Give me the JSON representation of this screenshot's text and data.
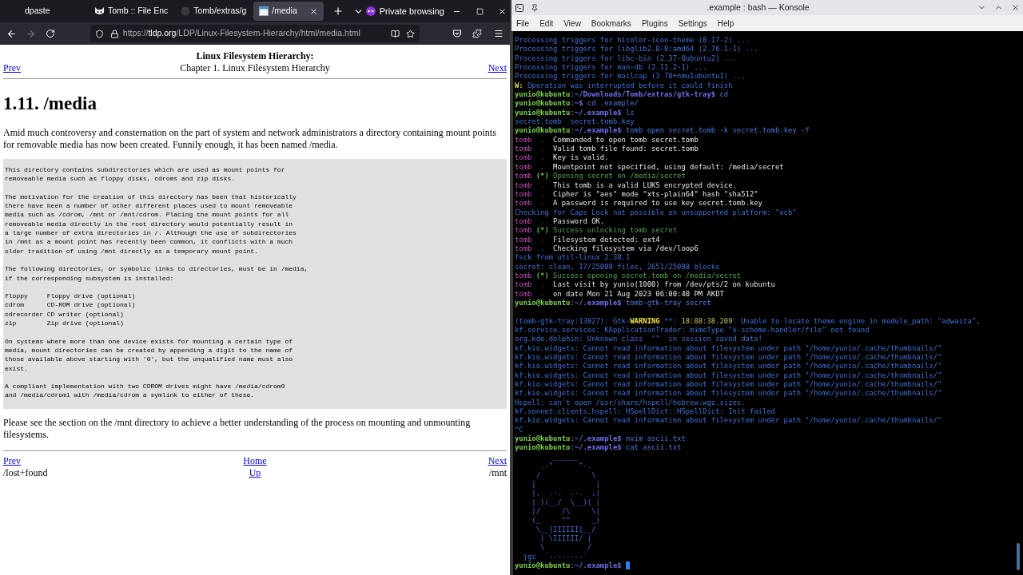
{
  "browser": {
    "tabs": [
      {
        "label": "dpaste",
        "selected": false
      },
      {
        "label": "Tomb :: File Enc",
        "selected": false
      },
      {
        "label": "Tomb/extras/g",
        "selected": false
      },
      {
        "label": "/media",
        "selected": true
      }
    ],
    "private_label": "Private browsing",
    "url": {
      "scheme": "https://",
      "host": "tldp.org",
      "path": "/LDP/Linux-Filesystem-Hierarchy/html/media.html"
    }
  },
  "page": {
    "book_title": "Linux Filesystem Hierarchy:",
    "chapter": "Chapter 1. Linux Filesystem Hierarchy",
    "prev": "Prev",
    "next": "Next",
    "heading": "1.11. /media",
    "intro": "Amid much controversy and consternation on the part of system and network administrators a directory containing mount points for removable media has now been created. Funnily enough, it has been named /media.",
    "pre": "This directory contains subdirectories which are used as mount points for\nremoveable media such as floppy disks, cdroms and zip disks.\n\nThe motivation for the creation of this directory has been that historically\nthere have been a number of other different places used to mount removeable\nmedia such as /cdrom, /mnt or /mnt/cdrom. Placing the mount points for all\nremoveable media directly in the root directory would potentially result in\na large number of extra directories in /. Although the use of subdirectories\nin /mnt as a mount point has recently been common, it conflicts with a much\nolder tradition of using /mnt directly as a temporary mount point.\n\nThe following directories, or symbolic links to directories, must be in /media,\nif the corresponding subsystem is installed:\n\nfloppy     Floppy drive (optional)\ncdrom      CD-ROM drive (optional)\ncdrecorder CD writer (optional)\nzip        Zip drive (optional)\n\nOn systems where more than one device exists for mounting a certain type of\nmedia, mount directories can be created by appending a digit to the name of\nthose available above starting with '0', but the unqualified name must also\nexist.\n\nA compliant implementation with two CDROM drives might have /media/cdrom0\nand /media/cdrom1 with /media/cdrom a symlink to either of these.",
    "outro": "Please see the section on the /mnt directory to achieve a better understanding of the process on mounting and unmounting filesystems.",
    "footer": {
      "prev": "Prev",
      "home": "Home",
      "next": "Next",
      "prev_title": "/lost+found",
      "up": "Up",
      "next_title": "/mnt"
    }
  },
  "konsole": {
    "title": ".example : bash — Konsole",
    "menu": [
      "File",
      "Edit",
      "View",
      "Bookmarks",
      "Plugins",
      "Settings",
      "Help"
    ],
    "lines": [
      {
        "kind": "text",
        "segments": [
          {
            "kind": "info",
            "text": "Processing triggers for hicolor-icon-theme (0.17-2) ..."
          }
        ]
      },
      {
        "kind": "text",
        "segments": [
          {
            "kind": "info",
            "text": "Processing triggers for libglib2.0-0:amd64 (2.76.1-1) ..."
          }
        ]
      },
      {
        "kind": "text",
        "segments": [
          {
            "kind": "info",
            "text": "Processing triggers for libc-bin (2.37-0ubuntu2) ..."
          }
        ]
      },
      {
        "kind": "text",
        "segments": [
          {
            "kind": "info",
            "text": "Processing triggers for man-db (2.11.2-1) ..."
          }
        ]
      },
      {
        "kind": "text",
        "segments": [
          {
            "kind": "info",
            "text": "Processing triggers for mailcap (3.70+nmu1ubuntu1) ..."
          }
        ]
      },
      {
        "kind": "text",
        "segments": [
          {
            "kind": "warn",
            "text": "W:"
          },
          {
            "kind": "info",
            "text": " Operation was interrupted before it could finish"
          }
        ]
      },
      {
        "kind": "text",
        "segments": [
          {
            "kind": "user",
            "text": "yunio@kubuntu"
          },
          {
            "kind": "sep",
            "text": ":"
          },
          {
            "kind": "path",
            "text": "~/Downloads/Tomb/extras/gtk-tray$"
          },
          {
            "kind": "cmd",
            "text": " cd"
          }
        ]
      },
      {
        "kind": "text",
        "segments": [
          {
            "kind": "user",
            "text": "yunio@kubuntu"
          },
          {
            "kind": "sep",
            "text": ":"
          },
          {
            "kind": "path",
            "text": "~$"
          },
          {
            "kind": "cmd",
            "text": " cd .example/"
          }
        ]
      },
      {
        "kind": "text",
        "segments": [
          {
            "kind": "user",
            "text": "yunio@kubuntu"
          },
          {
            "kind": "sep",
            "text": ":"
          },
          {
            "kind": "path",
            "text": "~/.example$"
          },
          {
            "kind": "cmd",
            "text": " ls"
          }
        ]
      },
      {
        "kind": "text",
        "segments": [
          {
            "kind": "info",
            "text": "secret.tomb  secret.tomb.key"
          }
        ]
      },
      {
        "kind": "text",
        "segments": [
          {
            "kind": "user",
            "text": "yunio@kubuntu"
          },
          {
            "kind": "sep",
            "text": ":"
          },
          {
            "kind": "path",
            "text": "~/.example$"
          },
          {
            "kind": "cmd",
            "text": " tomb open secret.tomb -k secret.tomb.key -f"
          }
        ]
      },
      {
        "kind": "text",
        "segments": [
          {
            "kind": "tomb",
            "text": "tomb"
          },
          {
            "kind": "dot",
            "text": "  .  "
          },
          {
            "kind": "msg",
            "text": "Commanded to open tomb secret.tomb"
          }
        ]
      },
      {
        "kind": "text",
        "segments": [
          {
            "kind": "tomb",
            "text": "tomb"
          },
          {
            "kind": "dot",
            "text": "  .  "
          },
          {
            "kind": "msg",
            "text": "Valid tomb file found: secret.tomb"
          }
        ]
      },
      {
        "kind": "text",
        "segments": [
          {
            "kind": "tomb",
            "text": "tomb"
          },
          {
            "kind": "dot",
            "text": "  .  "
          },
          {
            "kind": "msg",
            "text": "Key is valid."
          }
        ]
      },
      {
        "kind": "text",
        "segments": [
          {
            "kind": "tomb",
            "text": "tomb"
          },
          {
            "kind": "dot",
            "text": "  .  "
          },
          {
            "kind": "msg",
            "text": "Mountpoint not specified, using default: /media/secret"
          }
        ]
      },
      {
        "kind": "text",
        "segments": [
          {
            "kind": "tomb",
            "text": "tomb"
          },
          {
            "kind": "star",
            "text": " (*) "
          },
          {
            "kind": "ok",
            "text": "Opening secret on /media/secret"
          }
        ]
      },
      {
        "kind": "text",
        "segments": [
          {
            "kind": "tomb",
            "text": "tomb"
          },
          {
            "kind": "dot",
            "text": "  .  "
          },
          {
            "kind": "msg",
            "text": "This tomb is a valid LUKS encrypted device."
          }
        ]
      },
      {
        "kind": "text",
        "segments": [
          {
            "kind": "tomb",
            "text": "tomb"
          },
          {
            "kind": "dot",
            "text": "  .  "
          },
          {
            "kind": "msg",
            "text": "Cipher is \"aes\" mode \"xts-plain64\" hash \"sha512\""
          }
        ]
      },
      {
        "kind": "text",
        "segments": [
          {
            "kind": "tomb",
            "text": "tomb"
          },
          {
            "kind": "dot",
            "text": "  .  "
          },
          {
            "kind": "msg",
            "text": "A password is required to use key secret.tomb.key"
          }
        ]
      },
      {
        "kind": "text",
        "segments": [
          {
            "kind": "info",
            "text": "Checking for Caps Lock not possible on unsupported platform: \"xcb\""
          }
        ]
      },
      {
        "kind": "text",
        "segments": [
          {
            "kind": "tomb",
            "text": "tomb"
          },
          {
            "kind": "dot",
            "text": "  .  "
          },
          {
            "kind": "msg",
            "text": "Password OK."
          }
        ]
      },
      {
        "kind": "text",
        "segments": [
          {
            "kind": "tomb",
            "text": "tomb"
          },
          {
            "kind": "star",
            "text": " (*) "
          },
          {
            "kind": "ok",
            "text": "Success unlocking tomb secret"
          }
        ]
      },
      {
        "kind": "text",
        "segments": [
          {
            "kind": "tomb",
            "text": "tomb"
          },
          {
            "kind": "dot",
            "text": "  .  "
          },
          {
            "kind": "msg",
            "text": "Filesystem detected: ext4"
          }
        ]
      },
      {
        "kind": "text",
        "segments": [
          {
            "kind": "tomb",
            "text": "tomb"
          },
          {
            "kind": "dot",
            "text": "  .  "
          },
          {
            "kind": "msg",
            "text": "Checking filesystem via /dev/loop6"
          }
        ]
      },
      {
        "kind": "text",
        "segments": [
          {
            "kind": "info",
            "text": "fsck from util-linux 2.38.1"
          }
        ]
      },
      {
        "kind": "text",
        "segments": [
          {
            "kind": "info",
            "text": "secret: clean, 17/25088 files, 2651/25088 blocks"
          }
        ]
      },
      {
        "kind": "text",
        "segments": [
          {
            "kind": "tomb",
            "text": "tomb"
          },
          {
            "kind": "star",
            "text": " (*) "
          },
          {
            "kind": "ok",
            "text": "Success opening secret.tomb on /media/secret"
          }
        ]
      },
      {
        "kind": "text",
        "segments": [
          {
            "kind": "tomb",
            "text": "tomb"
          },
          {
            "kind": "dot",
            "text": "  .  "
          },
          {
            "kind": "msg",
            "text": "Last visit by yunio(1000) from /dev/pts/2 on kubuntu"
          }
        ]
      },
      {
        "kind": "text",
        "segments": [
          {
            "kind": "tomb",
            "text": "tomb"
          },
          {
            "kind": "dot",
            "text": "  .  "
          },
          {
            "kind": "msg",
            "text": "on date Mon 21 Aug 2023 06:00:40 PM AKDT"
          }
        ]
      },
      {
        "kind": "text",
        "segments": [
          {
            "kind": "user",
            "text": "yunio@kubuntu"
          },
          {
            "kind": "sep",
            "text": ":"
          },
          {
            "kind": "path",
            "text": "~/.example$"
          },
          {
            "kind": "cmd",
            "text": " tomb-gtk-tray secret"
          }
        ]
      },
      {
        "kind": "blank"
      },
      {
        "kind": "text",
        "segments": [
          {
            "kind": "info",
            "text": "(tomb-gtk-tray:13827): Gtk-"
          },
          {
            "kind": "hl",
            "text": "WARNING"
          },
          {
            "kind": "info",
            "text": " **: "
          },
          {
            "kind": "time",
            "text": "18:08:38.209"
          },
          {
            "kind": "info",
            "text": ": Unable to locate theme engine in module_path: \"adwaita\","
          }
        ]
      },
      {
        "kind": "text",
        "segments": [
          {
            "kind": "info",
            "text": "kf.service.services: KApplicationTrader: mimeType \"x-scheme-handler/file\" not found"
          }
        ]
      },
      {
        "kind": "text",
        "segments": [
          {
            "kind": "info",
            "text": "org.kde.dolphin: Unknown class  \"\"  in session saved data!"
          }
        ]
      },
      {
        "kind": "text",
        "segments": [
          {
            "kind": "info",
            "text": "kf.kio.widgets: Cannot read information about filesystem under path \"/home/yunio/.cache/thumbnails/\""
          }
        ]
      },
      {
        "kind": "text",
        "segments": [
          {
            "kind": "info",
            "text": "kf.kio.widgets: Cannot read information about filesystem under path \"/home/yunio/.cache/thumbnails/\""
          }
        ]
      },
      {
        "kind": "text",
        "segments": [
          {
            "kind": "info",
            "text": "kf.kio.widgets: Cannot read information about filesystem under path \"/home/yunio/.cache/thumbnails/\""
          }
        ]
      },
      {
        "kind": "text",
        "segments": [
          {
            "kind": "info",
            "text": "kf.kio.widgets: Cannot read information about filesystem under path \"/home/yunio/.cache/thumbnails/\""
          }
        ]
      },
      {
        "kind": "text",
        "segments": [
          {
            "kind": "info",
            "text": "kf.kio.widgets: Cannot read information about filesystem under path \"/home/yunio/.cache/thumbnails/\""
          }
        ]
      },
      {
        "kind": "text",
        "segments": [
          {
            "kind": "info",
            "text": "kf.kio.widgets: Cannot read information about filesystem under path \"/home/yunio/.cache/thumbnails/\""
          }
        ]
      },
      {
        "kind": "text",
        "segments": [
          {
            "kind": "info",
            "text": "Hspell: can't open /usr/share/hspell/hebrew.wgz.sizes."
          }
        ]
      },
      {
        "kind": "text",
        "segments": [
          {
            "kind": "info",
            "text": "kf.sonnet.clients.hspell: HSpellDict::HSpellDict: Init failed"
          }
        ]
      },
      {
        "kind": "text",
        "segments": [
          {
            "kind": "info",
            "text": "kf.kio.widgets: Cannot read information about filesystem under path \"/home/yunio/.cache/thumbnails/\""
          }
        ]
      },
      {
        "kind": "text",
        "segments": [
          {
            "kind": "info",
            "text": "^C"
          }
        ]
      },
      {
        "kind": "text",
        "segments": [
          {
            "kind": "user",
            "text": "yunio@kubuntu"
          },
          {
            "kind": "sep",
            "text": ":"
          },
          {
            "kind": "path",
            "text": "~/.example$"
          },
          {
            "kind": "cmd",
            "text": " nvim ascii.txt"
          }
        ]
      },
      {
        "kind": "text",
        "segments": [
          {
            "kind": "user",
            "text": "yunio@kubuntu"
          },
          {
            "kind": "sep",
            "text": ":"
          },
          {
            "kind": "path",
            "text": "~/.example$"
          },
          {
            "kind": "cmd",
            "text": " cat ascii.txt"
          }
        ]
      },
      {
        "kind": "text",
        "segments": [
          {
            "kind": "art",
            "text": "         ______"
          }
        ]
      },
      {
        "kind": "text",
        "segments": [
          {
            "kind": "art",
            "text": "      .-\"      \"-."
          }
        ]
      },
      {
        "kind": "text",
        "segments": [
          {
            "kind": "art",
            "text": "     /            \\"
          }
        ]
      },
      {
        "kind": "text",
        "segments": [
          {
            "kind": "art",
            "text": "    |              |"
          }
        ]
      },
      {
        "kind": "text",
        "segments": [
          {
            "kind": "art",
            "text": "    |,  .-.  .-.  ,|"
          }
        ]
      },
      {
        "kind": "text",
        "segments": [
          {
            "kind": "art",
            "text": "    | )(__/  \\__)( |"
          }
        ]
      },
      {
        "kind": "text",
        "segments": [
          {
            "kind": "art",
            "text": "    |/     /\\     \\|"
          }
        ]
      },
      {
        "kind": "text",
        "segments": [
          {
            "kind": "art",
            "text": "    (_     ^^     _)"
          }
        ]
      },
      {
        "kind": "text",
        "segments": [
          {
            "kind": "art",
            "text": "     \\__|IIIIII|__/"
          }
        ]
      },
      {
        "kind": "text",
        "segments": [
          {
            "kind": "art",
            "text": "      | \\IIIIII/ |"
          }
        ]
      },
      {
        "kind": "text",
        "segments": [
          {
            "kind": "art",
            "text": "      \\          /"
          }
        ]
      },
      {
        "kind": "text",
        "segments": [
          {
            "kind": "art",
            "text": "  jgs  `--------`"
          }
        ]
      },
      {
        "kind": "text",
        "segments": [
          {
            "kind": "user",
            "text": "yunio@kubuntu"
          },
          {
            "kind": "sep",
            "text": ":"
          },
          {
            "kind": "path",
            "text": "~/.example$"
          },
          {
            "kind": "cursor"
          }
        ]
      }
    ]
  }
}
